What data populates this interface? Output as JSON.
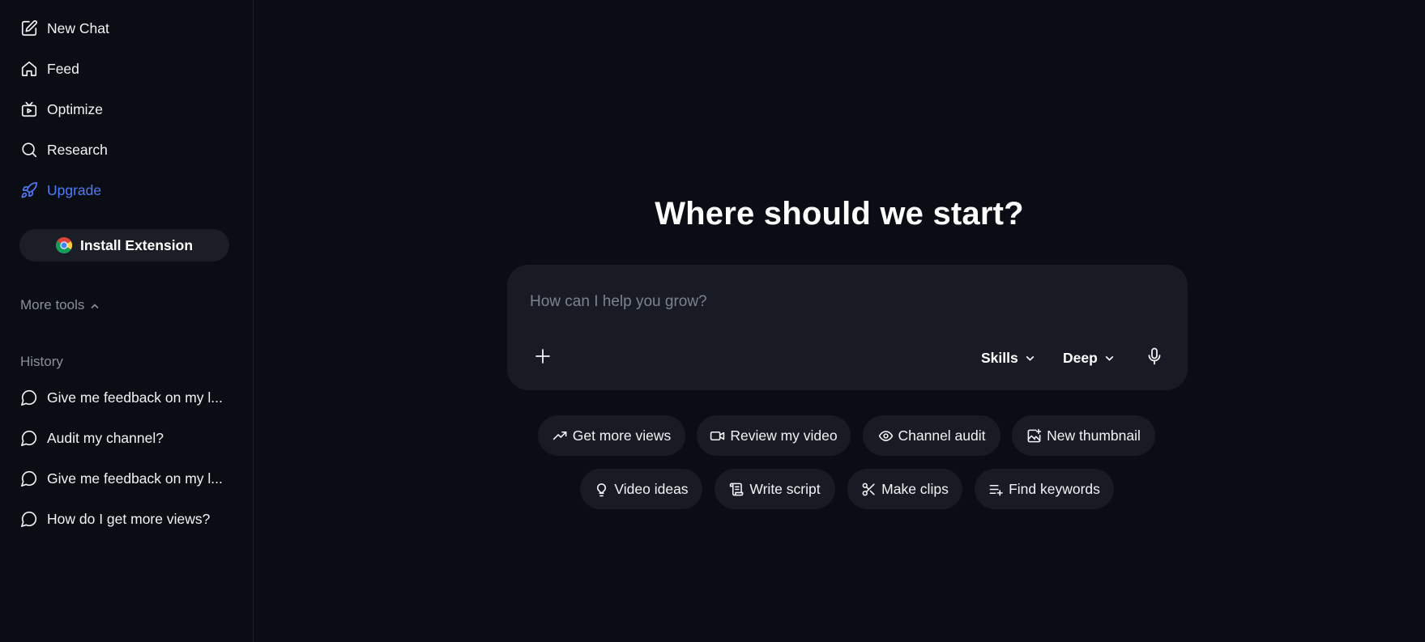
{
  "sidebar": {
    "nav": [
      {
        "label": "New Chat",
        "icon": "new-chat-icon"
      },
      {
        "label": "Feed",
        "icon": "home-icon"
      },
      {
        "label": "Optimize",
        "icon": "optimize-icon"
      },
      {
        "label": "Research",
        "icon": "search-icon"
      },
      {
        "label": "Upgrade",
        "icon": "rocket-icon"
      }
    ],
    "install_label": "Install Extension",
    "more_tools_label": "More tools",
    "history_title": "History",
    "history": [
      {
        "label": "Give me feedback on my l..."
      },
      {
        "label": "Audit my channel?"
      },
      {
        "label": "Give me feedback on my l..."
      },
      {
        "label": "How do I get more views?"
      }
    ]
  },
  "main": {
    "heading": "Where should we start?",
    "composer": {
      "placeholder": "How can I help you grow?",
      "skills_label": "Skills",
      "mode_label": "Deep"
    },
    "chips_row1": [
      {
        "label": "Get more views",
        "icon": "trending-up-icon"
      },
      {
        "label": "Review my video",
        "icon": "video-camera-icon"
      },
      {
        "label": "Channel audit",
        "icon": "eye-icon"
      },
      {
        "label": "New thumbnail",
        "icon": "image-sparkle-icon"
      }
    ],
    "chips_row2": [
      {
        "label": "Video ideas",
        "icon": "lightbulb-icon"
      },
      {
        "label": "Write script",
        "icon": "scroll-icon"
      },
      {
        "label": "Make clips",
        "icon": "scissors-icon"
      },
      {
        "label": "Find keywords",
        "icon": "list-plus-icon"
      }
    ]
  },
  "colors": {
    "background": "#0b0d14",
    "surface": "#181b24",
    "accent": "#4d7cf7",
    "muted": "#8a8f9c"
  }
}
